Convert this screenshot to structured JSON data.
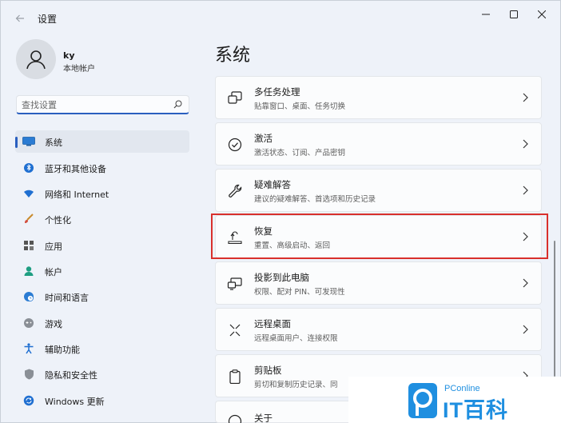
{
  "window": {
    "title": "设置",
    "controls": [
      "minimize-icon",
      "maximize-icon",
      "close-icon"
    ]
  },
  "profile": {
    "name": "ky",
    "account_type": "本地帐户"
  },
  "search": {
    "placeholder": "查找设置"
  },
  "sidebar": {
    "items": [
      {
        "label": "系统",
        "icon": "system-icon",
        "active": true
      },
      {
        "label": "蓝牙和其他设备",
        "icon": "bluetooth-icon"
      },
      {
        "label": "网络和 Internet",
        "icon": "wifi-icon"
      },
      {
        "label": "个性化",
        "icon": "brush-icon"
      },
      {
        "label": "应用",
        "icon": "apps-icon"
      },
      {
        "label": "帐户",
        "icon": "account-icon"
      },
      {
        "label": "时间和语言",
        "icon": "globe-clock-icon"
      },
      {
        "label": "游戏",
        "icon": "gamepad-icon"
      },
      {
        "label": "辅助功能",
        "icon": "accessibility-icon"
      },
      {
        "label": "隐私和安全性",
        "icon": "shield-icon"
      },
      {
        "label": "Windows 更新",
        "icon": "update-icon"
      }
    ]
  },
  "main": {
    "title": "系统",
    "cards": [
      {
        "title": "多任务处理",
        "subtitle": "贴靠窗口、桌面、任务切换",
        "icon": "multitasking-icon"
      },
      {
        "title": "激活",
        "subtitle": "激活状态、订阅、产品密钥",
        "icon": "activation-check-icon"
      },
      {
        "title": "疑难解答",
        "subtitle": "建议的疑难解答、首选项和历史记录",
        "icon": "wrench-icon"
      },
      {
        "title": "恢复",
        "subtitle": "重置、高级启动、返回",
        "icon": "recovery-icon",
        "highlighted": true
      },
      {
        "title": "投影到此电脑",
        "subtitle": "权限、配对 PIN、可发现性",
        "icon": "projection-icon"
      },
      {
        "title": "远程桌面",
        "subtitle": "远程桌面用户、连接权限",
        "icon": "remote-desktop-icon"
      },
      {
        "title": "剪贴板",
        "subtitle": "剪切和复制历史记录、同",
        "icon": "clipboard-icon"
      },
      {
        "title": "关于",
        "subtitle": "",
        "icon": "info-icon"
      }
    ]
  },
  "watermark": {
    "small": "PConline",
    "big": "IT百科"
  },
  "colors": {
    "accent": "#2a5fbf",
    "highlight": "#d9302c",
    "watermark": "#1f8fe0"
  }
}
